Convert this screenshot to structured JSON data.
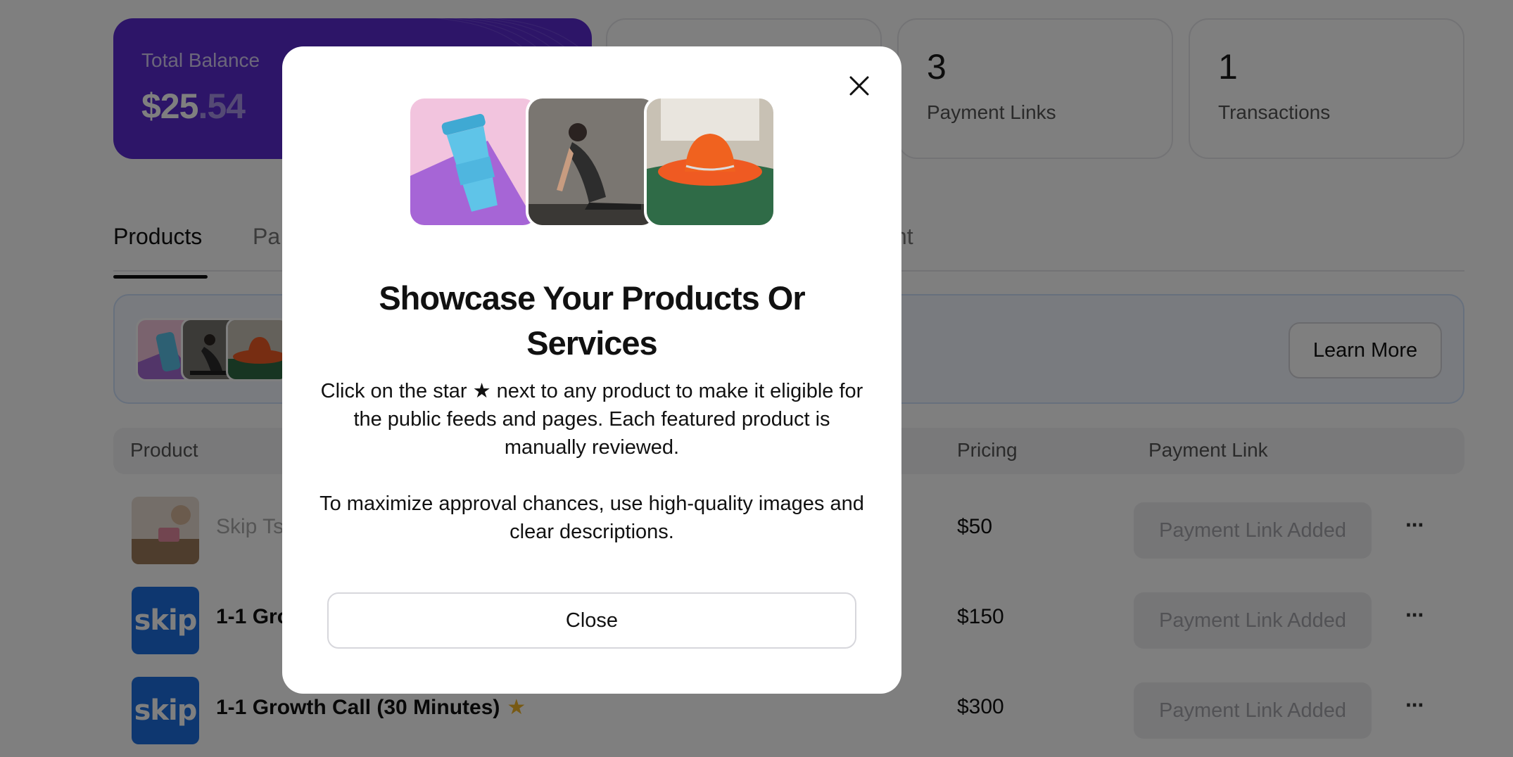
{
  "balance_card": {
    "label": "Total Balance",
    "amount_main": "$25",
    "amount_cents": ".54",
    "color": "#5b2bd0"
  },
  "stats": [
    {
      "value": "3",
      "label": "Payment Links"
    },
    {
      "value": "1",
      "label": "Transactions"
    }
  ],
  "tabs": [
    {
      "label": "Products",
      "active": true
    },
    {
      "label": "Pa",
      "active": false
    },
    {
      "label": "nt",
      "active": false
    }
  ],
  "banner": {
    "learn_more_label": "Learn More"
  },
  "table": {
    "headers": {
      "product": "Product",
      "pricing": "Pricing",
      "payment_link": "Payment Link"
    },
    "rows": [
      {
        "name": "Skip Ts",
        "price": "$50",
        "link_status": "Payment Link Added",
        "thumb": "photo",
        "star": ""
      },
      {
        "name": "1-1 Gro",
        "price": "$150",
        "link_status": "Payment Link Added",
        "thumb": "skip",
        "star": ""
      },
      {
        "name": "1-1 Growth Call (30 Minutes)",
        "price": "$300",
        "link_status": "Payment Link Added",
        "thumb": "skip",
        "star": "★"
      }
    ],
    "logo_text": "skip",
    "more_label": "···"
  },
  "modal": {
    "title": "Showcase Your Products Or Services",
    "paragraph_1": "Click on the star ★ next to any product to make it eligible for the public feeds and pages. Each featured product is manually reviewed.",
    "paragraph_2": "To maximize approval chances, use high-quality images and clear descriptions.",
    "close_button_label": "Close",
    "images": [
      "coffee-cup",
      "yoga-woman",
      "orange-hat"
    ]
  },
  "colors": {
    "accent": "#5b2bd0",
    "logo_blue": "#1d6fe0",
    "star": "#f0b429"
  }
}
